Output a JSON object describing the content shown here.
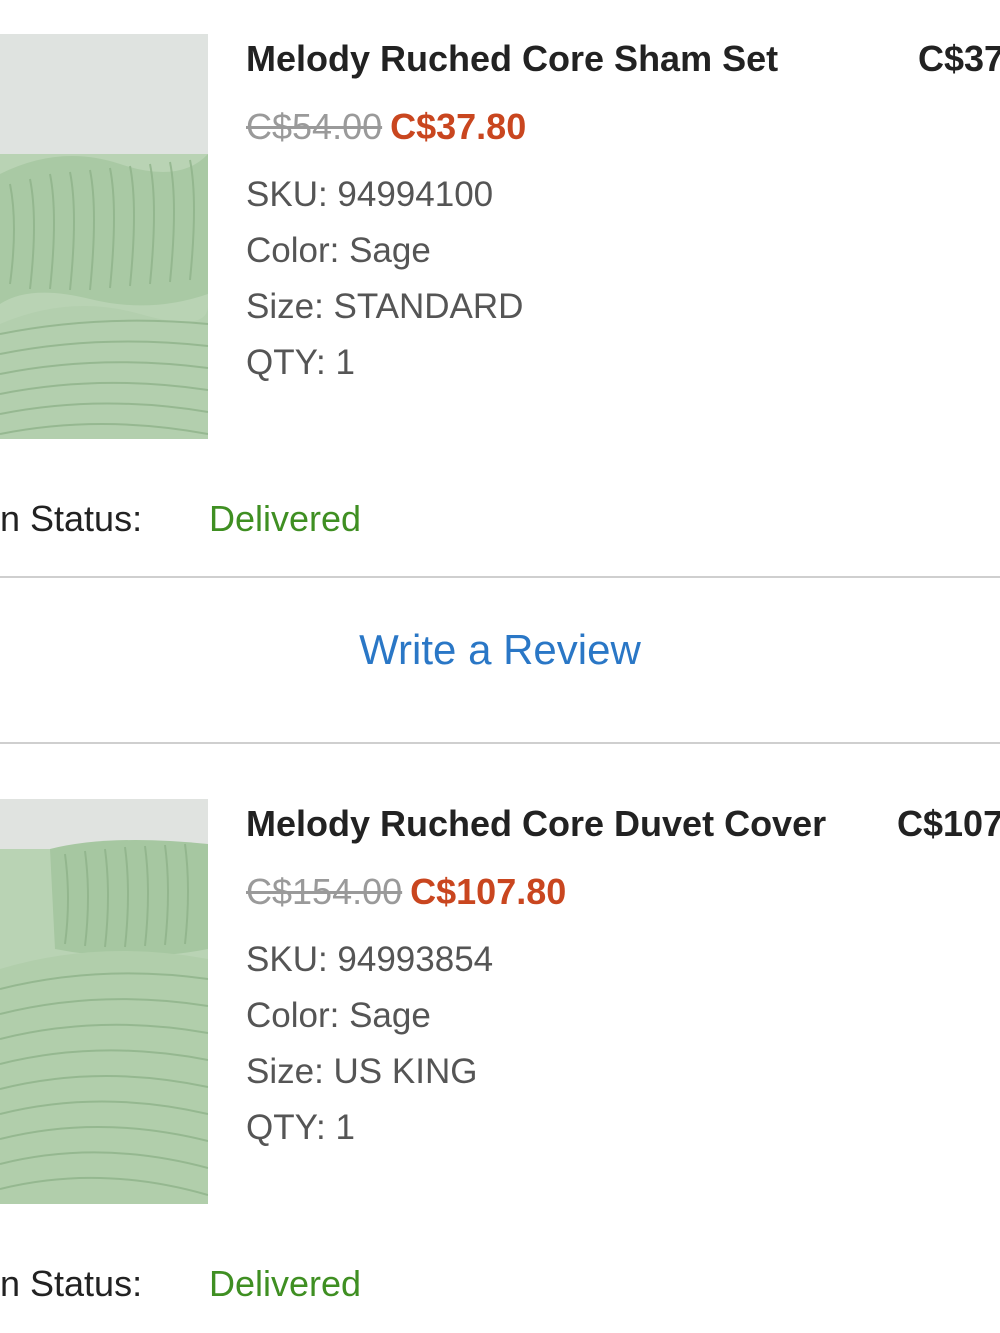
{
  "items": [
    {
      "title": "Melody Ruched Core Sham Set",
      "line_total": "C$37",
      "original_price": "C$54.00",
      "sale_price": "C$37.80",
      "sku": "SKU: 94994100",
      "color": "Color: Sage",
      "size": "Size: STANDARD",
      "qty": "QTY: 1",
      "status_label": "n Status:",
      "status_value": "Delivered",
      "image_icon": "product-photo"
    },
    {
      "title": "Melody Ruched Core Duvet Cover",
      "line_total": "C$107",
      "original_price": "C$154.00",
      "sale_price": "C$107.80",
      "sku": "SKU: 94993854",
      "color": "Color: Sage",
      "size": "Size: US KING",
      "qty": "QTY: 1",
      "status_label": "n Status:",
      "status_value": "Delivered",
      "image_icon": "product-photo"
    }
  ],
  "review_link": "Write a Review",
  "colors": {
    "sale": "#c9461f",
    "delivered": "#3f8f22",
    "link": "#2a77c6",
    "strikethrough": "#9a9a9a",
    "sage": "#b9d3b4"
  }
}
